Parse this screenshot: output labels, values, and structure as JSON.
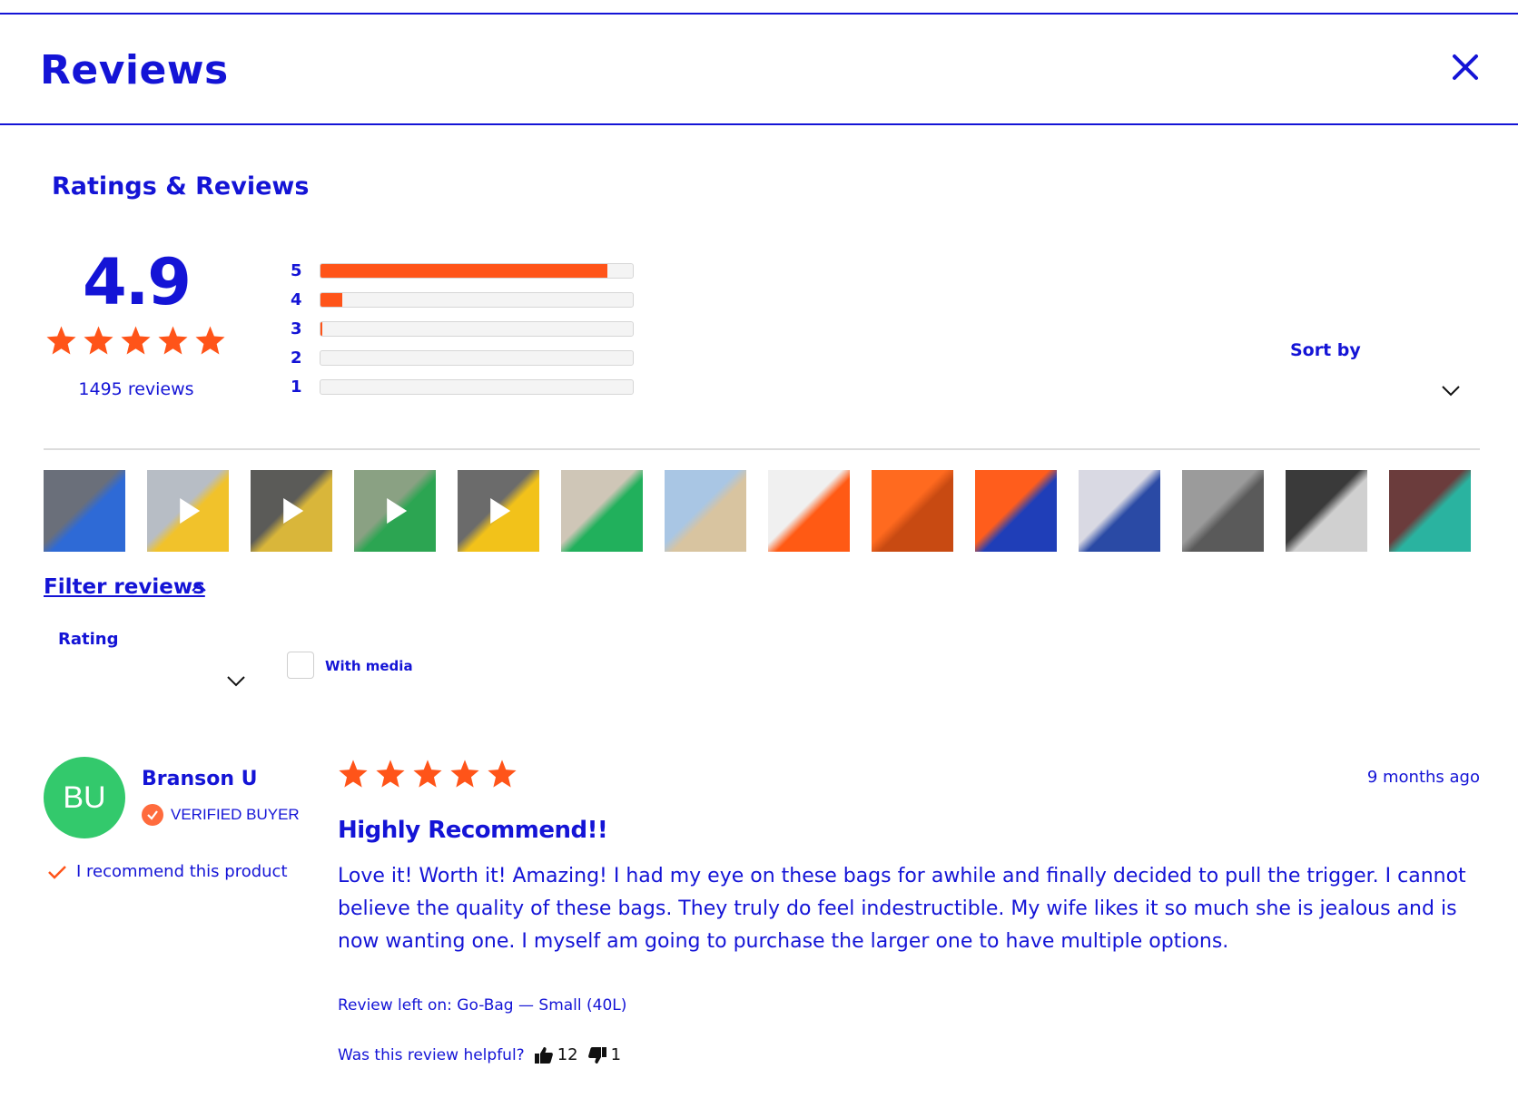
{
  "header": {
    "title": "Reviews"
  },
  "summary": {
    "section_title": "Ratings & Reviews",
    "average": "4.9",
    "stars_filled": 5,
    "review_count": "1495 reviews",
    "histogram": [
      {
        "label": "5",
        "fraction": 0.92
      },
      {
        "label": "4",
        "fraction": 0.07
      },
      {
        "label": "3",
        "fraction": 0.006
      },
      {
        "label": "2",
        "fraction": 0.0
      },
      {
        "label": "1",
        "fraction": 0.0
      }
    ]
  },
  "sort": {
    "label": "Sort by"
  },
  "media_thumbs": [
    {
      "name": "black bag contents",
      "video": false,
      "colors": [
        "#6a6f7a",
        "#2e6ad6"
      ]
    },
    {
      "name": "person with yellow bag",
      "video": true,
      "colors": [
        "#b7bdc5",
        "#f1c22b"
      ]
    },
    {
      "name": "bags in trunk",
      "video": true,
      "colors": [
        "#5b5b58",
        "#d9b63a"
      ]
    },
    {
      "name": "selfie green bag",
      "video": true,
      "colors": [
        "#8aa183",
        "#2ca552"
      ]
    },
    {
      "name": "yellow bag on couch",
      "video": true,
      "colors": [
        "#6b6b6b",
        "#f2c21a"
      ]
    },
    {
      "name": "green bag open",
      "video": false,
      "colors": [
        "#cfc6b7",
        "#21b05c"
      ]
    },
    {
      "name": "beach tent",
      "video": false,
      "colors": [
        "#a9c6e4",
        "#d8c4a0"
      ]
    },
    {
      "name": "orange bag bench",
      "video": false,
      "colors": [
        "#f0f0f0",
        "#ff5a14"
      ]
    },
    {
      "name": "orange bag open",
      "video": false,
      "colors": [
        "#ff6a1f",
        "#c84a12"
      ]
    },
    {
      "name": "book cover",
      "video": false,
      "colors": [
        "#ff5d1c",
        "#1f3eb8"
      ]
    },
    {
      "name": "patterned bag",
      "video": false,
      "colors": [
        "#d9d9e3",
        "#2a4aa5"
      ]
    },
    {
      "name": "grey bag closeup",
      "video": false,
      "colors": [
        "#9b9b9b",
        "#5a5a5a"
      ]
    },
    {
      "name": "black bag contents",
      "video": false,
      "colors": [
        "#3a3a3a",
        "#d0d0d0"
      ]
    },
    {
      "name": "colorful bag",
      "video": false,
      "colors": [
        "#6b3c3c",
        "#2ab3a0"
      ]
    }
  ],
  "filters": {
    "toggle_label": "Filter reviews",
    "rating_label": "Rating",
    "media_label": "With media"
  },
  "review": {
    "initials": "BU",
    "author": "Branson U",
    "verified": "VERIFIED BUYER",
    "recommend": "I recommend this product",
    "stars": 5,
    "date": "9 months ago",
    "title": "Highly Recommend!!",
    "body": "Love it! Worth it! Amazing! I had my eye on these bags for awhile and finally decided to pull the trigger. I cannot believe the quality of these bags. They truly do feel indestructible. My wife likes it so much she is jealous and is now wanting one. I myself am going to purchase the larger one to have multiple options.",
    "product": "Review left on: Go-Bag — Small (40L)",
    "helpful_label": "Was this review helpful?",
    "upvotes": "12",
    "downvotes": "1"
  },
  "colors": {
    "brand": "#1414d6",
    "accent": "#ff5419",
    "avatar": "#33c96c"
  }
}
